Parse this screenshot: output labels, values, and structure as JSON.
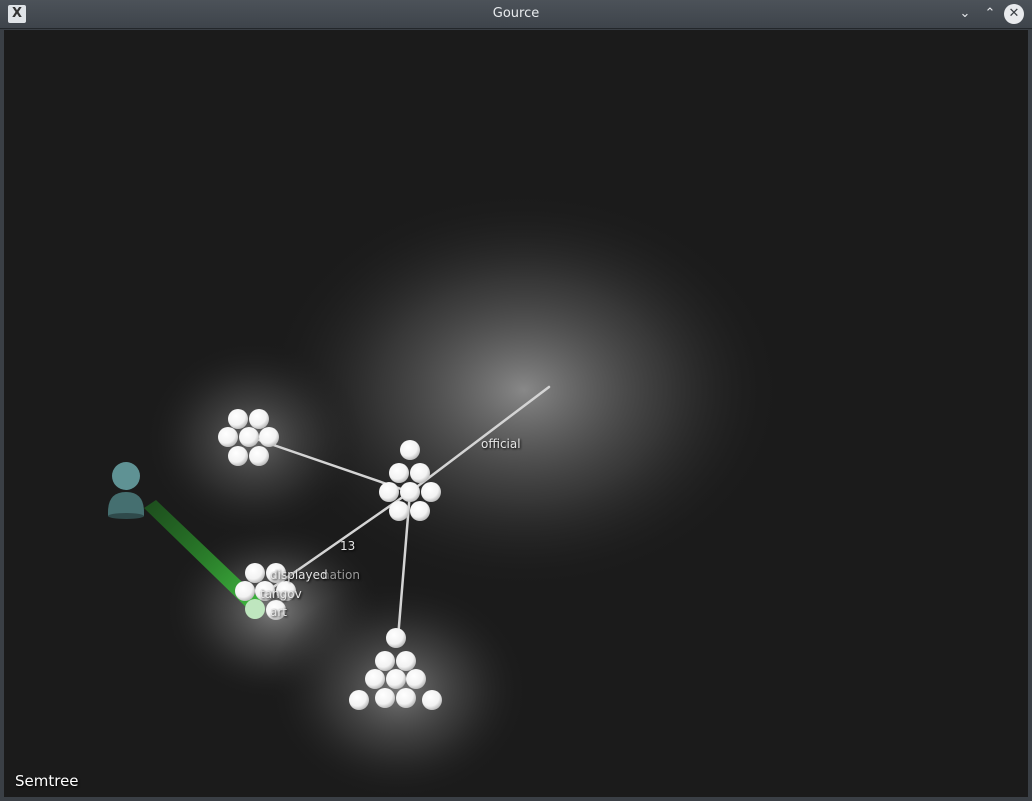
{
  "window": {
    "title": "Gource",
    "app_icon": "x-app-icon",
    "controls": {
      "minimize": "⌄",
      "maximize": "⌃",
      "close": "✕"
    }
  },
  "visualization": {
    "caption": "Semtree",
    "labels": {
      "official": "official",
      "count": "13",
      "displayed": "displayed",
      "nation": "nation",
      "tangov": "tangov",
      "art": "art"
    },
    "colors": {
      "background": "#1b1b1b",
      "glow": "#8a8a8a",
      "file_node": "#ffffff",
      "branch": "#d0d0d0",
      "user": "#4a7f7f",
      "beam": "#2e9a2e"
    }
  }
}
